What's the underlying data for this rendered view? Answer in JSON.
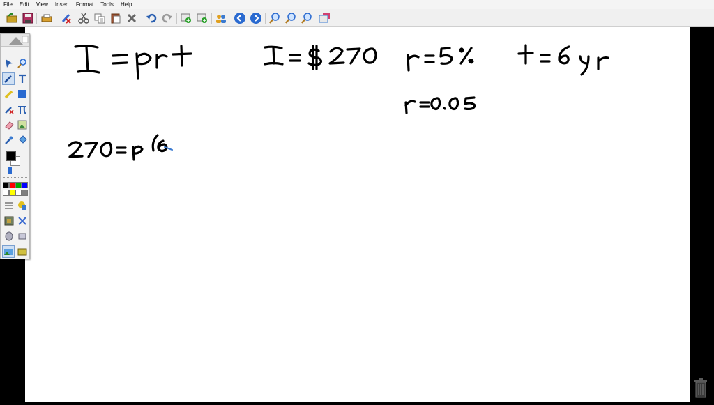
{
  "menu": {
    "items": [
      "File",
      "Edit",
      "View",
      "Insert",
      "Format",
      "Tools",
      "Help"
    ]
  },
  "toolbar": {
    "icons": [
      "open-icon",
      "save-icon",
      "print-icon",
      "pen-off-icon",
      "cut-icon",
      "copy-icon",
      "paste-icon",
      "delete-icon",
      "undo-icon",
      "redo-icon",
      "add-page-icon",
      "duplicate-page-icon",
      "users-icon",
      "previous-page-icon",
      "next-page-icon",
      "zoom-in-icon",
      "zoom-out-icon",
      "zoom-fit-icon",
      "screen-capture-icon"
    ]
  },
  "palette": {
    "tools": [
      "select-arrow-icon",
      "magnifier-icon",
      "pen-icon",
      "text-icon",
      "highlighter-icon",
      "rectangle-icon",
      "pen-delete-icon",
      "pi-icon",
      "eraser-icon",
      "image-icon",
      "eyedropper-icon",
      "fill-bucket-icon"
    ],
    "colors": [
      "#000000",
      "#ff0000",
      "#00aa00",
      "#0000ff",
      "#ffffff",
      "#ffff00",
      "#ffffff",
      "#7f7f7f"
    ],
    "current_color": "#000000"
  },
  "canvas": {
    "line1": {
      "formula": "I = prt",
      "interest": "I = $270",
      "rate": "r = 5%",
      "time": "t = 6 yr"
    },
    "line2": {
      "rate_decimal": "r=0.05"
    },
    "line3": {
      "work": "270 =p",
      "partial": "(6"
    }
  }
}
